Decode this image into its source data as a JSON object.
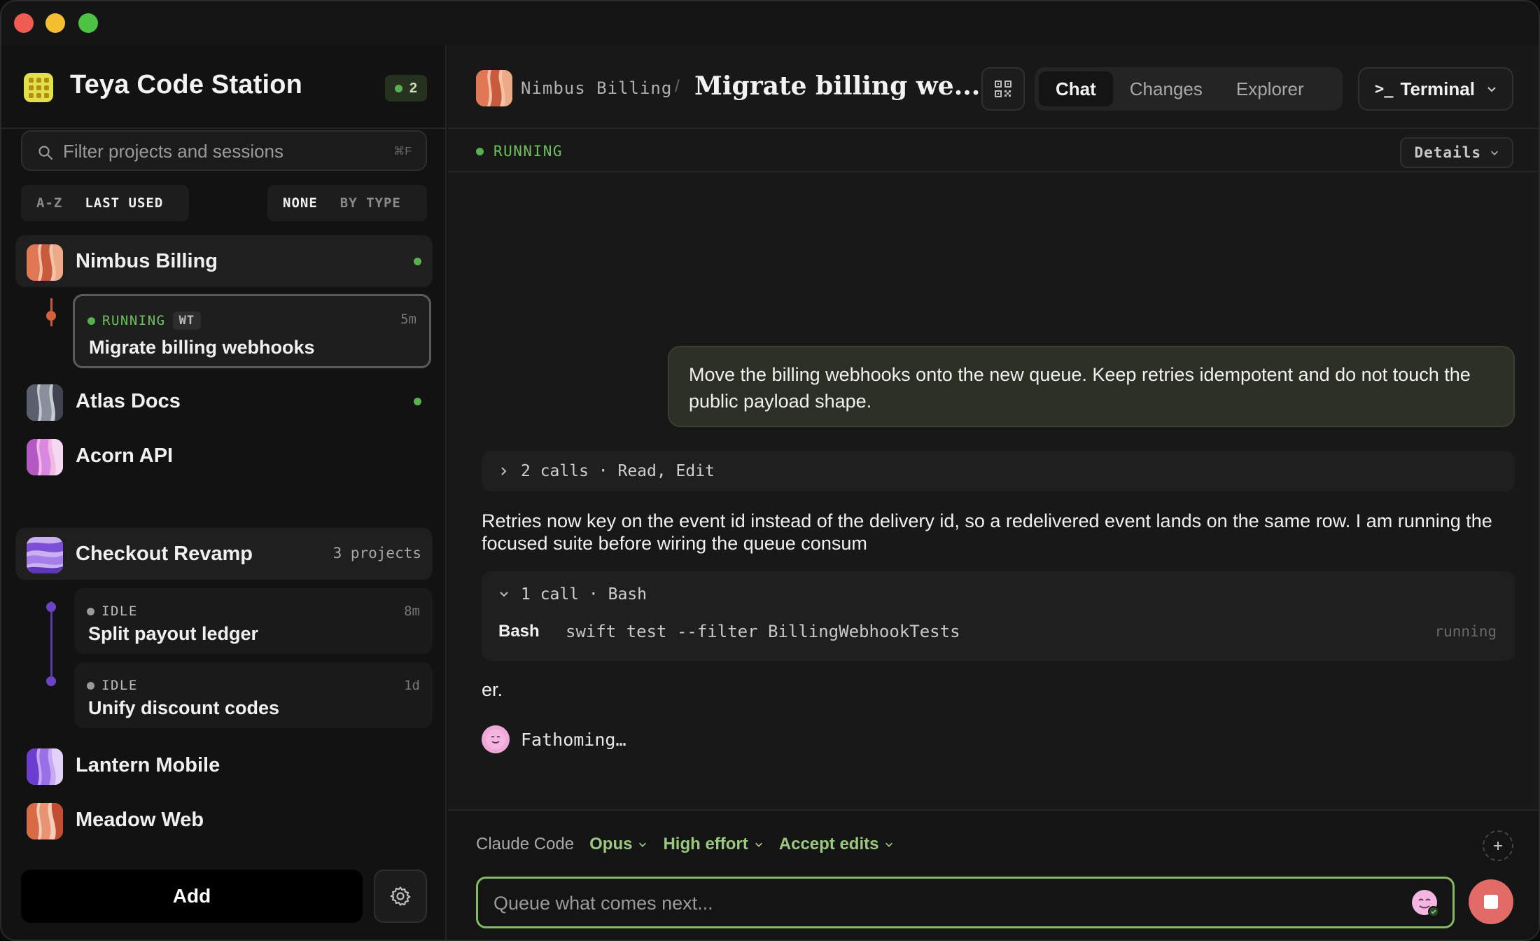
{
  "app": {
    "title": "Teya Code Station",
    "badge_count": "2"
  },
  "colors": {
    "accent_green": "#58b050",
    "running_green": "#6fbf5f",
    "stop_red": "#e26b67"
  },
  "filter": {
    "placeholder": "Filter projects and sessions",
    "shortcut": "⌘F"
  },
  "sort": {
    "options": [
      "A-Z",
      "LAST USED"
    ],
    "selected": "LAST USED"
  },
  "group": {
    "options": [
      "NONE",
      "BY TYPE"
    ],
    "selected": "NONE"
  },
  "projects": [
    {
      "name": "Nimbus Billing",
      "meta": "",
      "status": "green"
    },
    {
      "name": "Atlas Docs",
      "meta": "",
      "status": "green"
    },
    {
      "name": "Acorn API",
      "meta": "",
      "status": ""
    },
    {
      "name": "Checkout Revamp",
      "meta": "3 projects",
      "status": ""
    },
    {
      "name": "Lantern Mobile",
      "meta": "",
      "status": ""
    },
    {
      "name": "Meadow Web",
      "meta": "",
      "status": ""
    }
  ],
  "sessions": [
    {
      "status": "RUNNING",
      "tag": "WT",
      "time": "5m",
      "title": "Migrate billing webhooks"
    },
    {
      "status": "IDLE",
      "tag": "",
      "time": "8m",
      "title": "Split payout ledger"
    },
    {
      "status": "IDLE",
      "tag": "",
      "time": "1d",
      "title": "Unify discount codes"
    }
  ],
  "sidebar_footer": {
    "add_label": "Add"
  },
  "header": {
    "project": "Nimbus Billing",
    "separator": "/",
    "session_title": "Migrate billing we...",
    "tabs": [
      "Chat",
      "Changes",
      "Explorer"
    ],
    "active_tab": "Chat",
    "terminal_label": "Terminal",
    "terminal_prompt": ">_"
  },
  "status": {
    "label": "RUNNING",
    "details_label": "Details"
  },
  "chat": {
    "user_message": "Move the billing webhooks onto the new queue. Keep retries idempotent and do not touch the public payload shape.",
    "calls_summary": "2 calls · Read, Edit",
    "assistant_message": "Retries now key on the event id instead of the delivery id, so a redelivered event lands on the same row. I am running the focused suite before wiring the queue consum",
    "tool": {
      "summary": "1 call · Bash",
      "name": "Bash",
      "command": "swift test --filter BillingWebhookTests",
      "state": "running"
    },
    "tail": "er.",
    "thinking": "Fathoming…"
  },
  "composer": {
    "agent": "Claude Code",
    "model": "Opus",
    "effort": "High effort",
    "mode": "Accept edits",
    "placeholder": "Queue what comes next..."
  }
}
